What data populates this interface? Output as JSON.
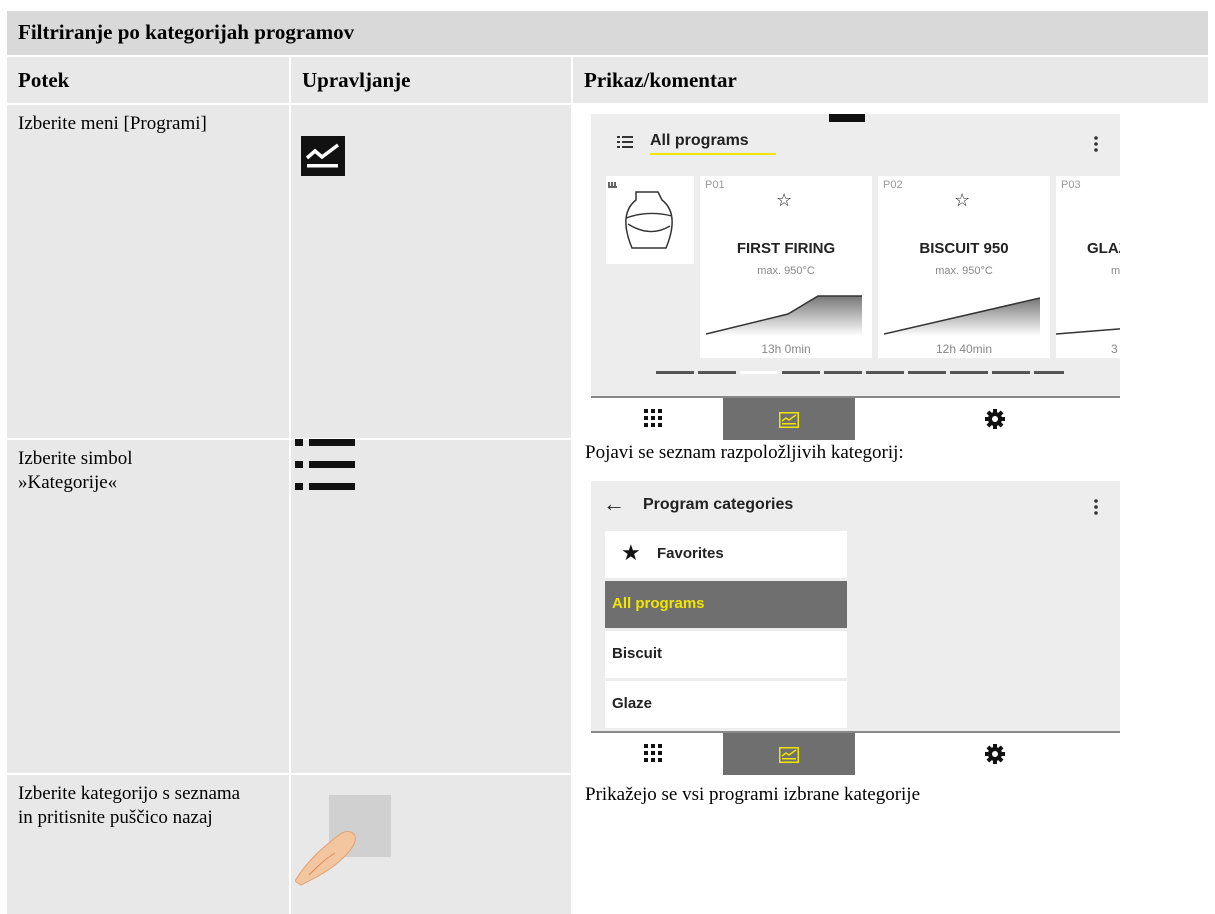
{
  "table": {
    "title": "Filtriranje po kategorijah programov",
    "headers": [
      "Potek",
      "Upravljanje",
      "Prikaz/komentar"
    ],
    "rows": [
      {
        "step": "Izberite meni [Programi]",
        "comment": ""
      },
      {
        "step": "Izberite simbol »Kategorije«",
        "comment": "Pojavi se seznam razpoložljivih kategorij:"
      },
      {
        "step": "Izberite kategorijo s seznama in pritisnite puščico nazaj",
        "comment": "Prikažejo se vsi programi izbrane kategorije"
      }
    ]
  },
  "screen1": {
    "title": "All programs",
    "accent": "#f2e600",
    "programs": [
      {
        "num": "P01",
        "name": "FIRST FIRING",
        "max": "max. 950°C",
        "time": "13h 0min"
      },
      {
        "num": "P02",
        "name": "BISCUIT 950",
        "max": "max. 950°C",
        "time": "12h 40min"
      },
      {
        "num": "P03",
        "name": "GLAZE",
        "max": "m",
        "time": "3"
      }
    ]
  },
  "screen2": {
    "title": "Program categories",
    "categories": [
      "Favorites",
      "All programs",
      "Biscuit",
      "Glaze"
    ],
    "selected": "All programs"
  },
  "icons": [
    "programs-chart-icon",
    "list-icon",
    "finger-tap-icon",
    "apps-grid-icon",
    "gear-icon",
    "star-icon",
    "kiln-vase-icon",
    "back-arrow-icon",
    "more-vert-icon"
  ]
}
